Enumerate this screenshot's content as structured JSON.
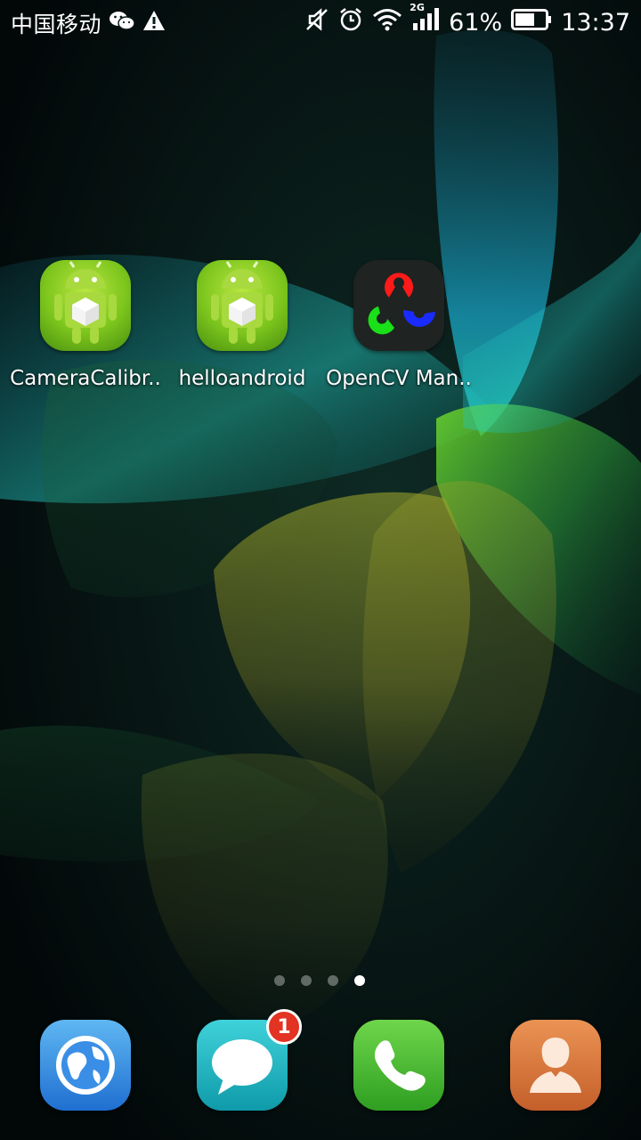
{
  "status_bar": {
    "carrier": "中国移动",
    "network_type": "2G",
    "battery_percent": "61%",
    "time": "13:37",
    "icons": [
      "wechat-icon",
      "warning-icon",
      "mute-icon",
      "alarm-icon",
      "wifi-icon",
      "signal-icon",
      "battery-icon"
    ]
  },
  "home_apps": [
    {
      "label": "CameraCalibr..",
      "icon": "android-app-icon"
    },
    {
      "label": "helloandroid",
      "icon": "android-app-icon"
    },
    {
      "label": "OpenCV Man..",
      "icon": "opencv-icon"
    }
  ],
  "page_indicator": {
    "total": 4,
    "active_index": 3
  },
  "dock": [
    {
      "name": "browser",
      "icon": "globe-icon",
      "color": "#2f8fe3"
    },
    {
      "name": "messages",
      "icon": "message-bubble-icon",
      "color": "#23b7c5",
      "badge": "1"
    },
    {
      "name": "phone",
      "icon": "phone-icon",
      "color": "#4cbd2d"
    },
    {
      "name": "contacts",
      "icon": "contact-person-icon",
      "color": "#d9743a"
    }
  ]
}
